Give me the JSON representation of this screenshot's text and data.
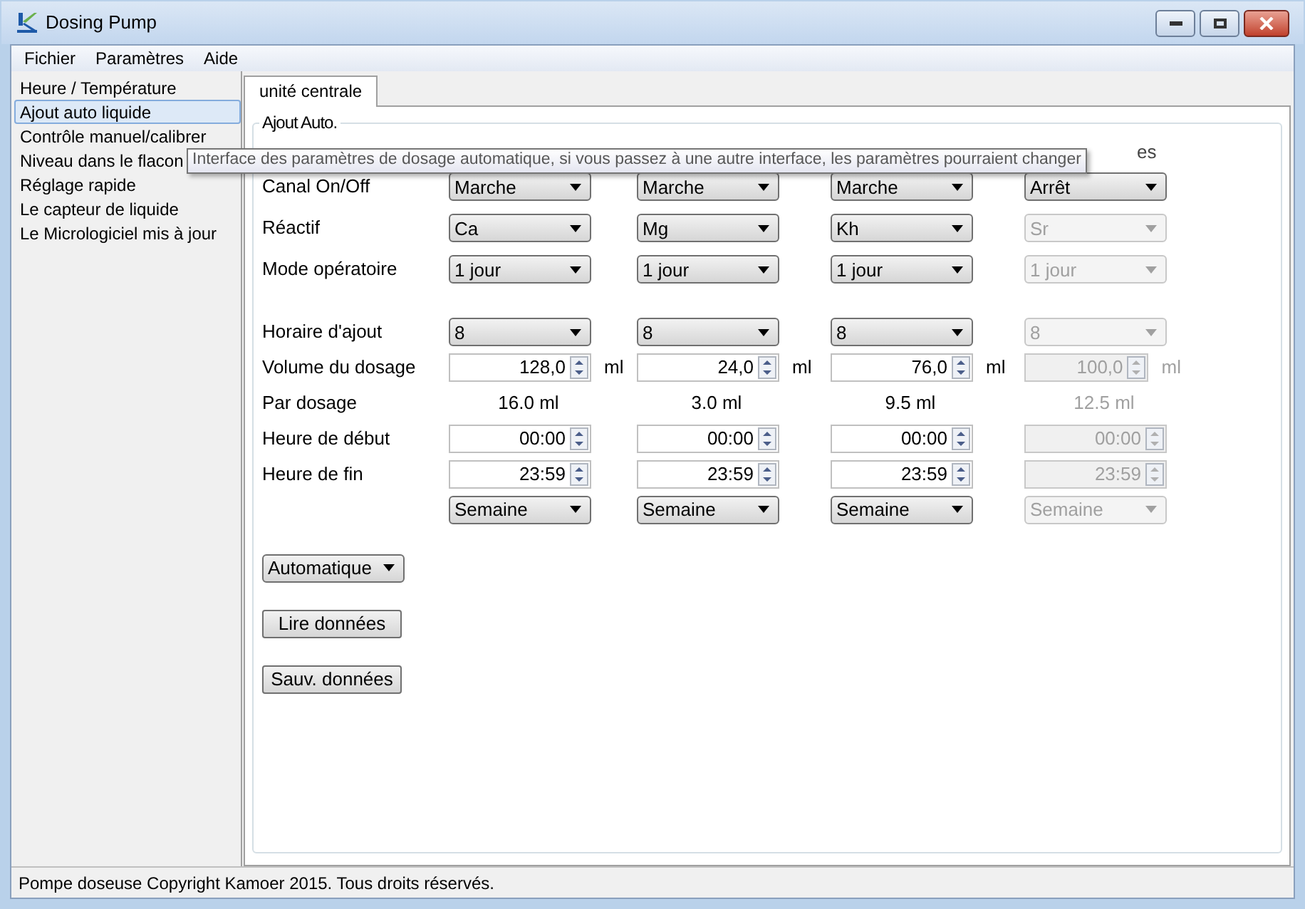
{
  "window": {
    "title": "Dosing Pump"
  },
  "menu": [
    "Fichier",
    "Paramètres",
    "Aide"
  ],
  "sidebar": {
    "items": [
      {
        "label": "Heure / Température",
        "selected": false
      },
      {
        "label": "Ajout auto liquide",
        "selected": true
      },
      {
        "label": "Contrôle manuel/calibrer",
        "selected": false
      },
      {
        "label": "Niveau dans le flacon",
        "selected": false
      },
      {
        "label": "Réglage rapide",
        "selected": false
      },
      {
        "label": "Le capteur de liquide",
        "selected": false
      },
      {
        "label": "Le Micrologiciel mis à jour",
        "selected": false
      }
    ]
  },
  "tabs": [
    {
      "label": "unité centrale",
      "selected": true
    }
  ],
  "group": {
    "title": "Ajout Auto.",
    "hidden_header_fragment": "es"
  },
  "tooltip": "Interface des paramètres de dosage automatique, si vous passez à une autre interface, les paramètres pourraient changer",
  "row_labels": {
    "on_off": "Canal On/Off",
    "reagent": "Réactif",
    "mode": "Mode opératoire",
    "schedule": "Horaire d'ajout",
    "volume": "Volume du dosage",
    "per_dose": "Par dosage",
    "start": "Heure de début",
    "end": "Heure de fin"
  },
  "channels": [
    {
      "disabled": false,
      "on_off": "Marche",
      "reagent": "Ca",
      "mode": "1 jour",
      "schedule": "8",
      "volume": "128,0",
      "unit": "ml",
      "per_dose": "16.0 ml",
      "start": "00:00",
      "end": "23:59",
      "period": "Semaine"
    },
    {
      "disabled": false,
      "on_off": "Marche",
      "reagent": "Mg",
      "mode": "1 jour",
      "schedule": "8",
      "volume": "24,0",
      "unit": "ml",
      "per_dose": "3.0 ml",
      "start": "00:00",
      "end": "23:59",
      "period": "Semaine"
    },
    {
      "disabled": false,
      "on_off": "Marche",
      "reagent": "Kh",
      "mode": "1 jour",
      "schedule": "8",
      "volume": "76,0",
      "unit": "ml",
      "per_dose": "9.5 ml",
      "start": "00:00",
      "end": "23:59",
      "period": "Semaine"
    },
    {
      "disabled": true,
      "on_off": "Arrêt",
      "reagent": "Sr",
      "mode": "1 jour",
      "schedule": "8",
      "volume": "100,0",
      "unit": "ml",
      "per_dose": "12.5 ml",
      "start": "00:00",
      "end": "23:59",
      "period": "Semaine"
    }
  ],
  "mode_select": "Automatique",
  "buttons": [
    "Lire données",
    "Sauv. données"
  ],
  "status_bar": "Pompe doseuse Copyright Kamoer 2015. Tous droits réservés."
}
